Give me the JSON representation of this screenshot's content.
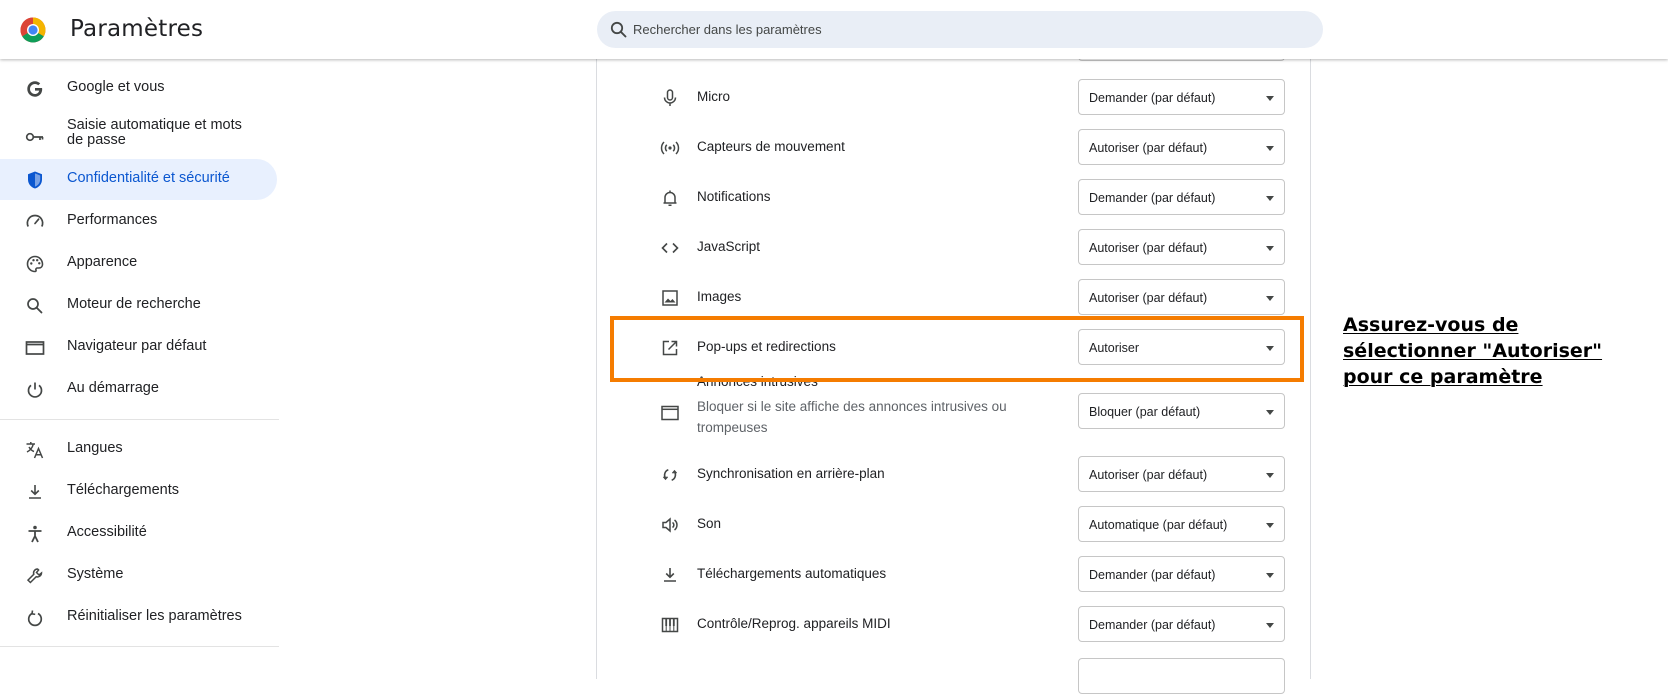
{
  "header": {
    "title": "Paramètres",
    "logo_icon": "chrome-logo-icon",
    "search": {
      "placeholder": "Rechercher dans les paramètres",
      "icon": "search-icon"
    }
  },
  "sidebar": {
    "items": [
      {
        "label": "Google et vous",
        "icon": "google-g-icon",
        "active": false
      },
      {
        "label": "Saisie automatique et mots de passe",
        "icon": "key-icon",
        "active": false
      },
      {
        "label": "Confidentialité et sécurité",
        "icon": "shield-icon",
        "active": true
      },
      {
        "label": "Performances",
        "icon": "speedometer-icon",
        "active": false
      },
      {
        "label": "Apparence",
        "icon": "palette-icon",
        "active": false
      },
      {
        "label": "Moteur de recherche",
        "icon": "search-icon",
        "active": false
      },
      {
        "label": "Navigateur par défaut",
        "icon": "browser-window-icon",
        "active": false
      },
      {
        "label": "Au démarrage",
        "icon": "power-icon",
        "active": false
      },
      {
        "label": "Langues",
        "icon": "translate-icon",
        "active": false
      },
      {
        "label": "Téléchargements",
        "icon": "download-icon",
        "active": false
      },
      {
        "label": "Accessibilité",
        "icon": "accessibility-icon",
        "active": false
      },
      {
        "label": "Système",
        "icon": "wrench-icon",
        "active": false
      },
      {
        "label": "Réinitialiser les paramètres",
        "icon": "reset-icon",
        "active": false
      }
    ]
  },
  "permissions": [
    {
      "label": "Micro",
      "icon": "microphone-icon",
      "value": "Demander (par défaut)"
    },
    {
      "label": "Capteurs de mouvement",
      "icon": "motion-sensor-icon",
      "value": "Autoriser (par défaut)"
    },
    {
      "label": "Notifications",
      "icon": "bell-icon",
      "value": "Demander (par défaut)"
    },
    {
      "label": "JavaScript",
      "icon": "code-icon",
      "value": "Autoriser (par défaut)"
    },
    {
      "label": "Images",
      "icon": "image-icon",
      "value": "Autoriser (par défaut)"
    },
    {
      "label": "Pop-ups et redirections",
      "icon": "open-in-new-icon",
      "value": "Autoriser"
    },
    {
      "label": "Annonces intrusives",
      "sublabel": "Bloquer si le site affiche des annonces intrusives ou trompeuses",
      "icon": "ads-window-icon",
      "value": "Bloquer (par défaut)"
    },
    {
      "label": "Synchronisation en arrière-plan",
      "icon": "sync-icon",
      "value": "Autoriser (par défaut)"
    },
    {
      "label": "Son",
      "icon": "speaker-icon",
      "value": "Automatique (par défaut)"
    },
    {
      "label": "Téléchargements automatiques",
      "icon": "download-icon",
      "value": "Demander (par défaut)"
    },
    {
      "label": "Contrôle/Reprog. appareils MIDI",
      "icon": "piano-icon",
      "value": "Demander (par défaut)"
    }
  ],
  "annotation": {
    "text": "Assurez-vous de sélectionner \"Autoriser\" pour ce paramètre",
    "highlight_color": "#f57c00"
  },
  "colors": {
    "accent": "#0b57d0",
    "active_bg": "#e8f0fe",
    "search_bg": "#e9eef6"
  }
}
